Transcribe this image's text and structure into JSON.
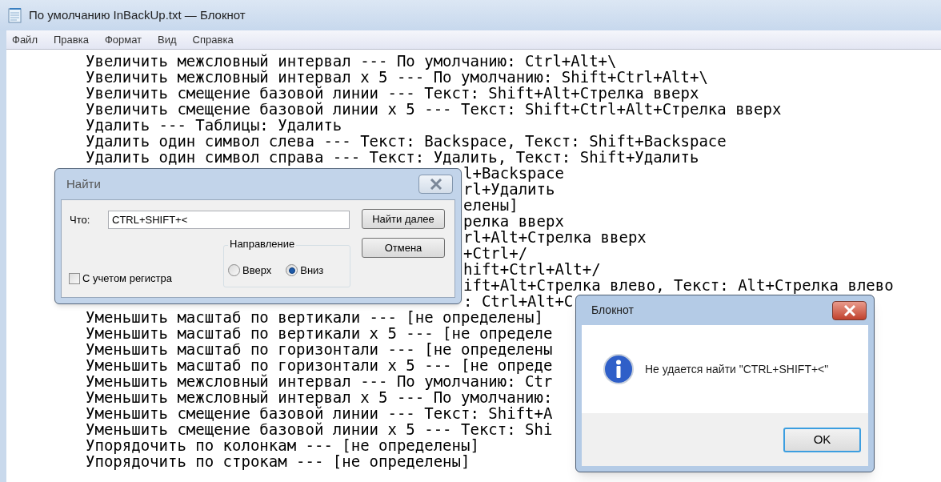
{
  "window": {
    "title": "По умолчанию InBackUp.txt — Блокнот"
  },
  "menu": [
    "Файл",
    "Правка",
    "Формат",
    "Вид",
    "Справка"
  ],
  "editor": {
    "lines": [
      {
        "kind": "full",
        "text": "Увеличить межсловный интервал --- По умолчанию: Ctrl+Alt+\\"
      },
      {
        "kind": "full",
        "text": "Увеличить межсловный интервал x 5 --- По умолчанию: Shift+Ctrl+Alt+\\"
      },
      {
        "kind": "full",
        "text": "Увеличить смещение базовой линии --- Текст: Shift+Alt+Стрелка вверх"
      },
      {
        "kind": "full",
        "text": "Увеличить смещение базовой линии x 5 --- Текст: Shift+Ctrl+Alt+Стрелка вверх"
      },
      {
        "kind": "full",
        "text": "Удалить --- Таблицы: Удалить"
      },
      {
        "kind": "full",
        "text": "Удалить один символ слева --- Текст: Backspace, Текст: Shift+Backspace"
      },
      {
        "kind": "full",
        "text": "Удалить один символ справа --- Текст: Удалить, Текст: Shift+Удалить"
      },
      {
        "kind": "after_find",
        "text": "l+Backspace"
      },
      {
        "kind": "after_find",
        "text": "rl+Удалить"
      },
      {
        "kind": "after_find",
        "text": "елены]"
      },
      {
        "kind": "after_find",
        "text": "релка вверх"
      },
      {
        "kind": "after_find",
        "text": "rl+Alt+Стрелка вверх"
      },
      {
        "kind": "after_find",
        "text": "+Ctrl+/"
      },
      {
        "kind": "after_find",
        "text": "hift+Ctrl+Alt+/"
      },
      {
        "kind": "after_find",
        "text": "ift+Alt+Стрелка влево, Текст: Alt+Стрелка влево"
      },
      {
        "kind": "after_find",
        "text": ": Ctrl+Alt+C"
      },
      {
        "kind": "full",
        "text": "Уменьшить масштаб по вертикали --- [не определены]"
      },
      {
        "kind": "full",
        "text": "Уменьшить масштаб по вертикали x 5 --- [не определе"
      },
      {
        "kind": "full",
        "text": "Уменьшить масштаб по горизонтали --- [не определены"
      },
      {
        "kind": "full",
        "text": "Уменьшить масштаб по горизонтали x 5 --- [не опреде"
      },
      {
        "kind": "full",
        "text": "Уменьшить межсловный интервал --- По умолчанию: Ctr"
      },
      {
        "kind": "full",
        "text": "Уменьшить межсловный интервал x 5 --- По умолчанию:"
      },
      {
        "kind": "full",
        "text": "Уменьшить смещение базовой линии --- Текст: Shift+A"
      },
      {
        "kind": "full",
        "text": "Уменьшить смещение базовой линии x 5 --- Текст: Shi"
      },
      {
        "kind": "full",
        "text": "Упорядочить по колонкам --- [не определены]"
      },
      {
        "kind": "full",
        "text": "Упорядочить по строкам --- [не определены]"
      }
    ]
  },
  "find_dialog": {
    "title": "Найти",
    "what_label": "Что:",
    "query": "CTRL+SHIFT+<",
    "buttons": [
      "Найти далее",
      "Отмена"
    ],
    "direction": {
      "label": "Направление",
      "options": [
        {
          "label": "Вверх",
          "selected": false
        },
        {
          "label": "Вниз",
          "selected": true
        }
      ]
    },
    "match_case": {
      "label": "С учетом регистра",
      "checked": false
    }
  },
  "message_dialog": {
    "title": "Блокнот",
    "message": "Не удается найти \"CTRL+SHIFT+<\"",
    "button": "OK"
  }
}
